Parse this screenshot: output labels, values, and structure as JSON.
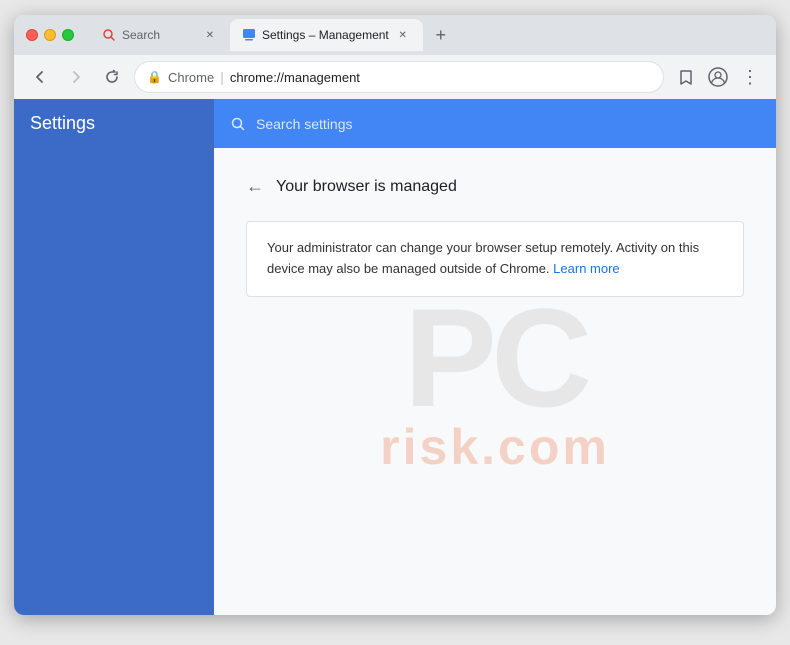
{
  "browser": {
    "tabs": [
      {
        "id": "tab-search",
        "title": "Search",
        "icon": "🔴",
        "active": false,
        "closeable": true
      },
      {
        "id": "tab-management",
        "title": "Settings – Management",
        "icon": "⚙",
        "active": true,
        "closeable": true
      }
    ],
    "new_tab_label": "+",
    "nav": {
      "back_disabled": false,
      "forward_disabled": true,
      "reload": true
    },
    "address_bar": {
      "security_label": "🔒",
      "host_label": "Chrome",
      "divider": "|",
      "url": "chrome://management"
    },
    "actions": {
      "bookmark": "☆",
      "account": "👤",
      "menu": "⋮"
    }
  },
  "settings": {
    "sidebar_title": "Settings",
    "search_placeholder": "Search settings",
    "page": {
      "back_arrow": "←",
      "title": "Your browser is managed",
      "info_text": "Your administrator can change your browser setup remotely. Activity on this device may also be managed outside of Chrome.",
      "learn_more_label": "Learn more"
    }
  },
  "watermark": {
    "top": "PC",
    "bottom": "risk.com"
  }
}
